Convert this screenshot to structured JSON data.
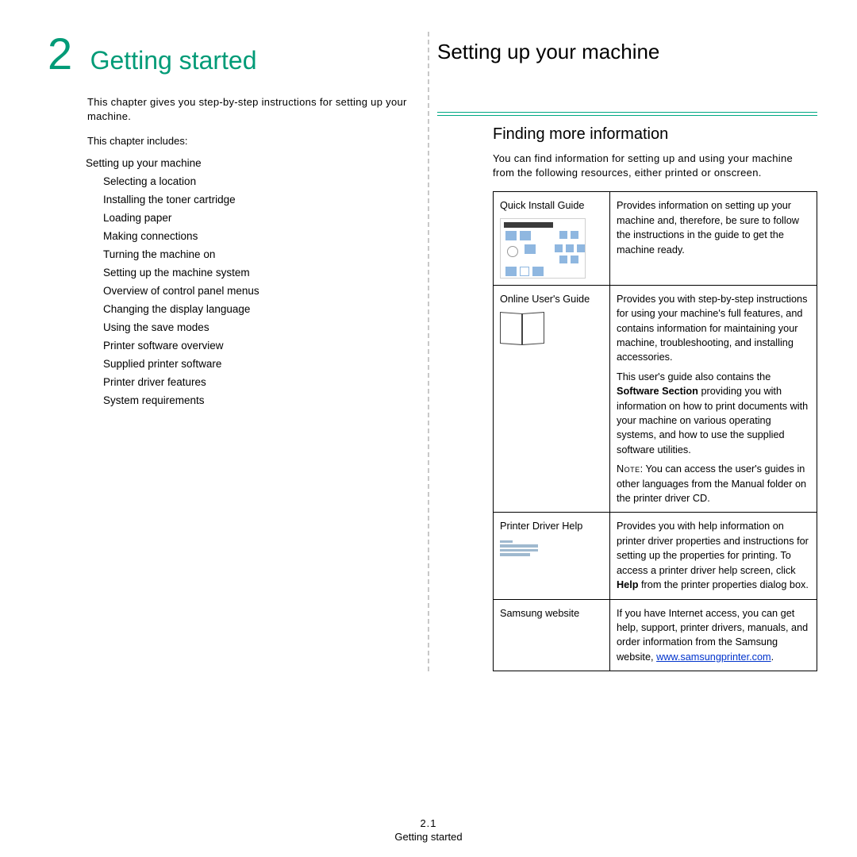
{
  "chapter": {
    "number": "2",
    "title": "Getting started"
  },
  "left": {
    "intro": "This chapter gives you step-by-step instructions for setting up your machine.",
    "includes": "This chapter includes:",
    "toc_root": "Setting up your machine",
    "toc": [
      "Selecting a location",
      "Installing the toner cartridge",
      "Loading paper",
      "Making connections",
      "Turning the machine on",
      "Setting up the machine system",
      "Overview of control panel menus",
      "Changing the display language",
      "Using the save modes",
      "Printer software overview",
      "Supplied printer software",
      "Printer driver features",
      "System requirements"
    ]
  },
  "right": {
    "h1": "Setting up your machine",
    "h2": "Finding more information",
    "lead": "You can find information for setting up and using your machine from the following resources, either printed or onscreen.",
    "rows": [
      {
        "label": "Quick Install Guide",
        "desc": "Provides information on setting up your machine and, therefore, be sure to follow the instructions in the guide to get the machine ready."
      },
      {
        "label": "Online User's Guide",
        "p1": "Provides you with step-by-step instructions for using your machine's full features, and contains information for maintaining your machine, troubleshooting, and installing accessories.",
        "p2a": "This user's guide also contains the ",
        "p2b": "Software Section",
        "p2c": " providing you with information on how to print documents with your machine on various operating systems, and how to use the supplied software utilities.",
        "note_label": "Note",
        "note": ": You can access the user's guides in other languages from the Manual folder on the printer driver CD."
      },
      {
        "label": "Printer Driver Help",
        "p1": "Provides you with help information on printer driver properties and instructions for setting up the properties for printing. To access a printer driver help screen, click ",
        "p1b": "Help",
        "p1c": " from the printer properties dialog box."
      },
      {
        "label": "Samsung website",
        "p1": "If you have Internet access, you can get help, support, printer drivers, manuals, and order information from the Samsung website, ",
        "link": "www.samsungprinter.com",
        "period": "."
      }
    ]
  },
  "footer": {
    "page": "2.1",
    "section": "Getting started"
  }
}
